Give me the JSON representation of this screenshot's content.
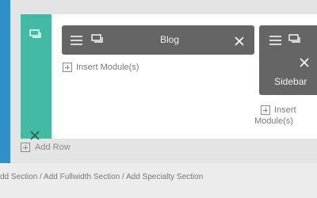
{
  "modules": {
    "blog_label": "Blog",
    "sidebar_label": "Sidebar"
  },
  "insert": {
    "left_label": "Insert Module(s)",
    "right_label_line1": "Insert",
    "right_label_line2": "Module(s)"
  },
  "row": {
    "add_row_label": "Add Row"
  },
  "footer": {
    "text": "dd Section / Add Fullwidth Section / Add Specialty Section"
  },
  "colors": {
    "accent_teal": "#43bba4",
    "module_gray": "#656565",
    "section_blue": "#2f8fc9"
  }
}
